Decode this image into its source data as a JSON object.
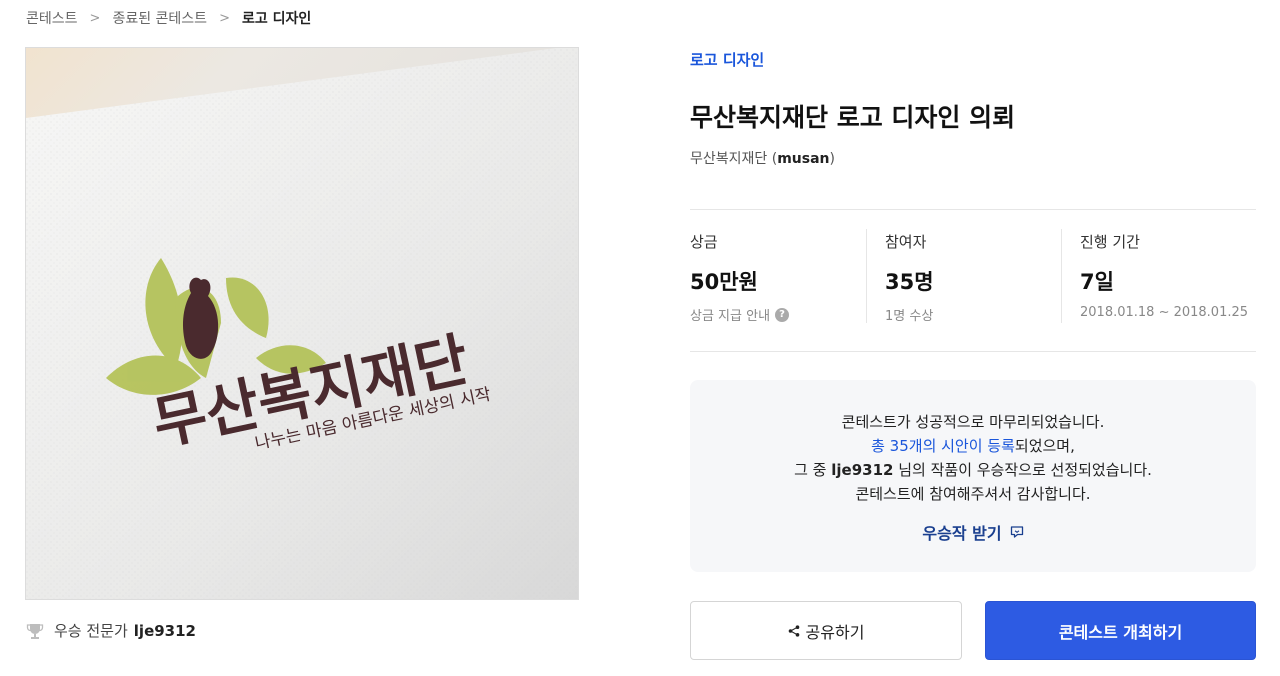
{
  "breadcrumb": {
    "items": [
      "콘테스트",
      "종료된 콘테스트"
    ],
    "current": "로고 디자인"
  },
  "image": {
    "logo_text": "무산복지재단",
    "slogan": "나누는 마음 아름다운 세상의 시작"
  },
  "winner": {
    "label": "우승 전문가",
    "name": "lje9312"
  },
  "contest": {
    "category": "로고 디자인",
    "title": "무산복지재단 로고 디자인 의뢰",
    "host_name": "무산복지재단",
    "host_id": "musan"
  },
  "stats": [
    {
      "label": "상금",
      "value": "50만원",
      "sub": "상금 지급 안내"
    },
    {
      "label": "참여자",
      "value": "35명",
      "sub": "1명 수상"
    },
    {
      "label": "진행 기간",
      "value": "7일",
      "sub": "2018.01.18 ~ 2018.01.25"
    }
  ],
  "notice": {
    "line1": "콘테스트가 성공적으로 마무리되었습니다.",
    "line2_highlight": "총 35개의 시안이 등록",
    "line2_rest": "되었으며,",
    "line3_pre": "그 중 ",
    "line3_name": "lje9312",
    "line3_rest": " 님의 작품이 우승작으로 선정되었습니다.",
    "line4": "콘테스트에 참여해주셔서 감사합니다.",
    "cta": "우승작 받기"
  },
  "buttons": {
    "share": "공유하기",
    "host": "콘테스트 개최하기"
  },
  "colors": {
    "accent": "#2d5be3",
    "link": "#1a56db",
    "logo_green": "#b4c25a",
    "logo_brown": "#4a2a2e"
  }
}
